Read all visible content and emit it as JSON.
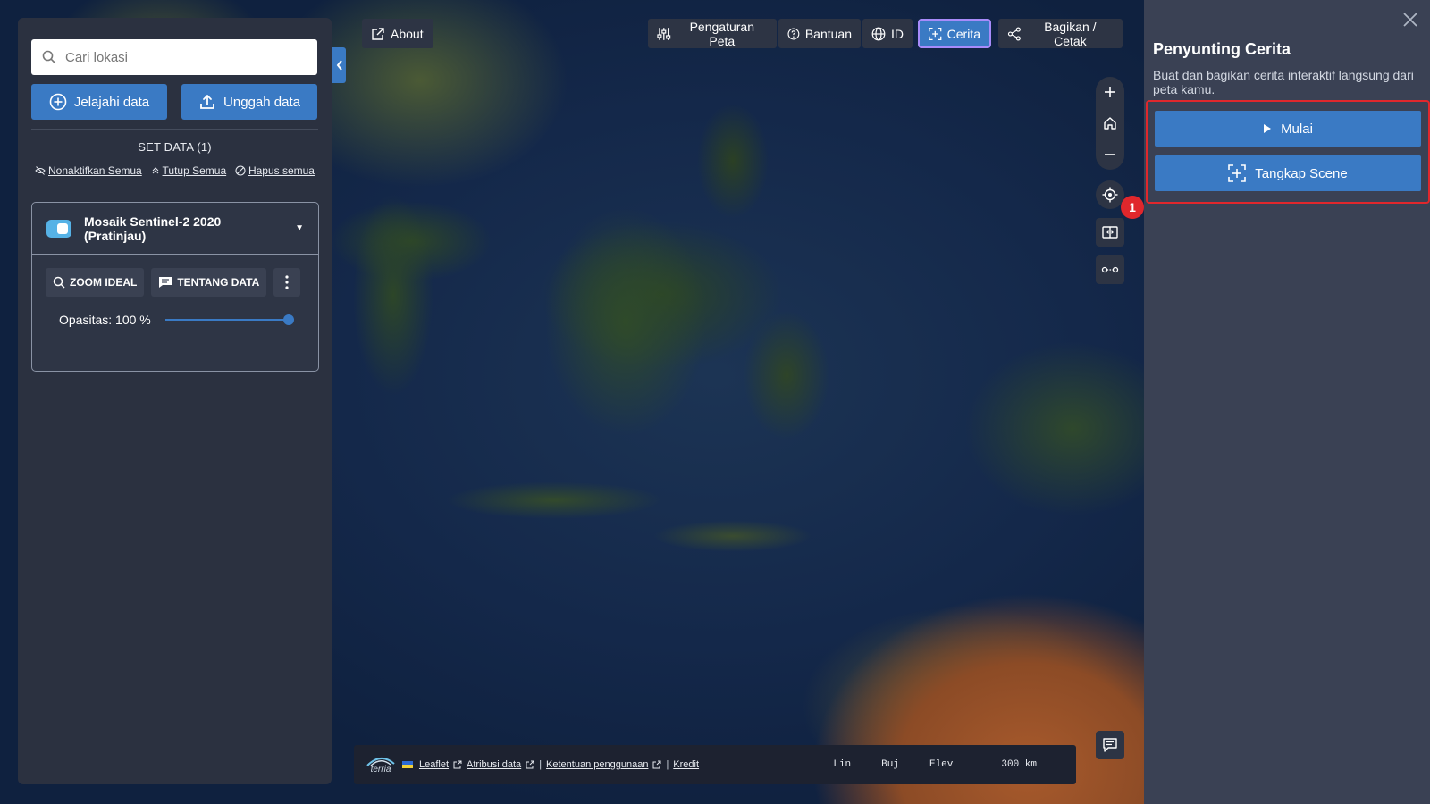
{
  "search": {
    "placeholder": "Cari lokasi"
  },
  "actions": {
    "explore_label": "Jelajahi data",
    "upload_label": "Unggah data"
  },
  "datasets": {
    "header": "SET DATA (1)",
    "disable_all": "Nonaktifkan Semua",
    "collapse_all": "Tutup Semua",
    "remove_all": "Hapus semua",
    "layer": {
      "title": "Mosaik Sentinel-2 2020 (Pratinjau)",
      "zoom_label": "ZOOM IDEAL",
      "about_label": "TENTANG DATA",
      "opacity_label": "Opasitas: 100 %",
      "opacity_value": 100,
      "enabled": true
    }
  },
  "topbar": {
    "about": "About",
    "map_settings": "Pengaturan Peta",
    "help": "Bantuan",
    "language": "ID",
    "story": "Cerita",
    "share": "Bagikan / Cetak"
  },
  "badge": {
    "value": "1"
  },
  "bottom": {
    "logo_text": "terria",
    "leaflet": "Leaflet",
    "attribution": "Atribusi data",
    "terms": "Ketentuan penggunaan",
    "credits": "Kredit",
    "lat_label": "Lin",
    "lon_label": "Buj",
    "elev_label": "Elev",
    "scale": "300 km"
  },
  "story_panel": {
    "title": "Penyunting Cerita",
    "description": "Buat dan bagikan cerita interaktif langsung dari peta kamu.",
    "start_label": "Mulai",
    "capture_label": "Tangkap Scene"
  },
  "colors": {
    "accent": "#3a7ac4",
    "panel": "#2b3140",
    "story_panel": "#3a4154",
    "highlight": "#e0272c",
    "story_btn_border": "#a78bfa"
  }
}
